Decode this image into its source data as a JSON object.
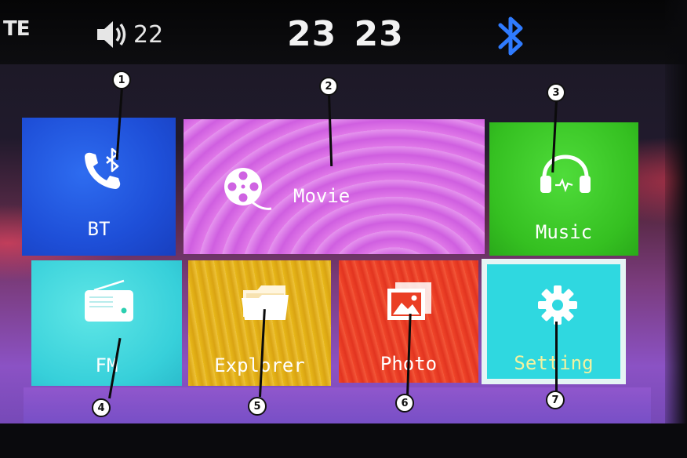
{
  "status_bar": {
    "left_text": "TE",
    "volume_value": "22",
    "clock": "23 23",
    "icons": [
      "speaker-icon",
      "bluetooth-icon"
    ],
    "bluetooth_color": "#2f7bff"
  },
  "tiles": [
    {
      "key": "bt",
      "label": "BT",
      "icon": "phone-bluetooth-icon",
      "color": "#2a62e8"
    },
    {
      "key": "movie",
      "label": "Movie",
      "icon": "film-reel-icon",
      "color": "#d36ae4"
    },
    {
      "key": "music",
      "label": "Music",
      "icon": "headphones-icon",
      "color": "#3fcb2c"
    },
    {
      "key": "fm",
      "label": "FM",
      "icon": "radio-icon",
      "color": "#3ccfd9"
    },
    {
      "key": "explorer",
      "label": "Explorer",
      "icon": "folder-icon",
      "color": "#e2ae1e"
    },
    {
      "key": "photo",
      "label": "Photo",
      "icon": "photo-gallery-icon",
      "color": "#ea3e24"
    },
    {
      "key": "setting",
      "label": "Setting",
      "icon": "gear-icon",
      "color": "#2fd8e0"
    }
  ],
  "callouts": [
    "1",
    "2",
    "3",
    "4",
    "5",
    "6",
    "7"
  ]
}
